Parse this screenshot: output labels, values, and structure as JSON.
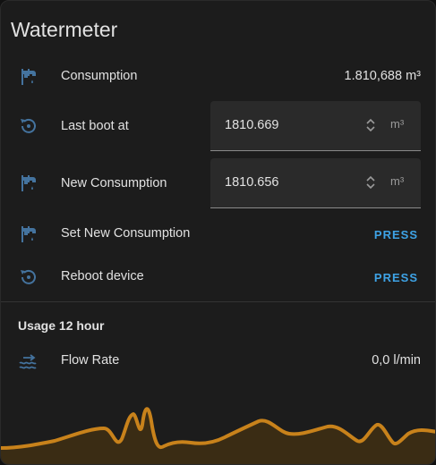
{
  "card": {
    "title": "Watermeter"
  },
  "entities": {
    "consumption": {
      "label": "Consumption",
      "value": "1.810,688 m³",
      "icon": "water-pump-icon"
    },
    "last_boot": {
      "label": "Last boot at",
      "value": "1810.669",
      "unit": "m³",
      "icon": "restart-icon"
    },
    "new_consumption": {
      "label": "New Consumption",
      "value": "1810.656",
      "unit": "m³",
      "icon": "water-pump-icon"
    },
    "set_new_consumption": {
      "label": "Set New Consumption",
      "action": "PRESS",
      "icon": "water-pump-icon"
    },
    "reboot_device": {
      "label": "Reboot device",
      "action": "PRESS",
      "icon": "restart-icon"
    }
  },
  "usage": {
    "section_title": "Usage 12 hour",
    "flow_rate": {
      "label": "Flow Rate",
      "value": "0,0 l/min",
      "icon": "wave-arrow-icon"
    }
  },
  "colors": {
    "accent": "#3ea3e6",
    "icon": "#44739e",
    "graph": "#c8821b"
  }
}
